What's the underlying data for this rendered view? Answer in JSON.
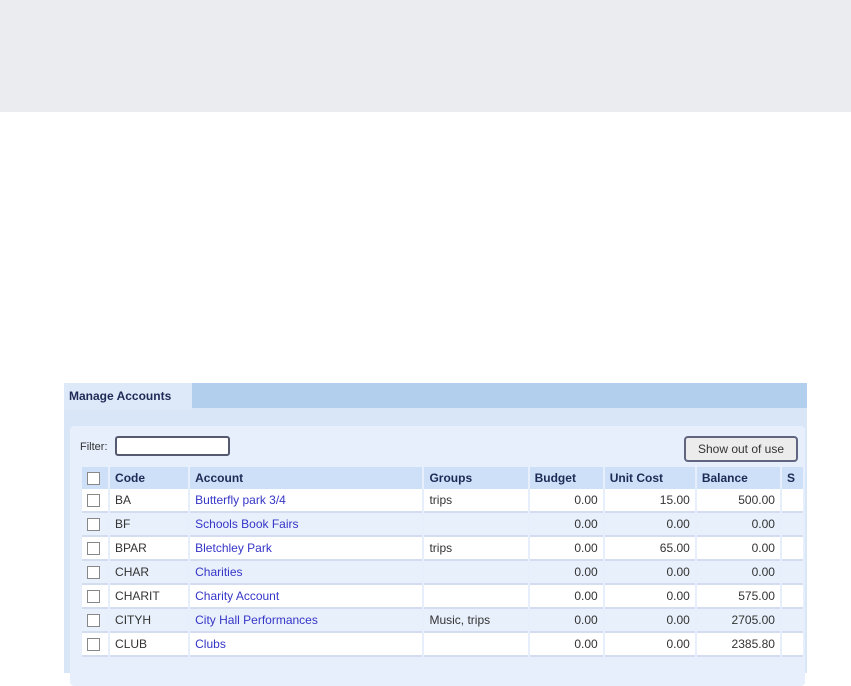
{
  "tab": "Manage Accounts",
  "filter": {
    "label": "Filter:",
    "value": ""
  },
  "show_out_of_use": "Show out of use",
  "columns": [
    "Code",
    "Account",
    "Groups",
    "Budget",
    "Unit Cost",
    "Balance",
    "S"
  ],
  "rows": [
    {
      "code": "BA",
      "account": "Butterfly park 3/4",
      "groups": "trips",
      "budget": "0.00",
      "unit_cost": "15.00",
      "balance": "500.00"
    },
    {
      "code": "BF",
      "account": "Schools Book Fairs",
      "groups": "",
      "budget": "0.00",
      "unit_cost": "0.00",
      "balance": "0.00"
    },
    {
      "code": "BPAR",
      "account": "Bletchley Park",
      "groups": "trips",
      "budget": "0.00",
      "unit_cost": "65.00",
      "balance": "0.00"
    },
    {
      "code": "CHAR",
      "account": "Charities",
      "groups": "",
      "budget": "0.00",
      "unit_cost": "0.00",
      "balance": "0.00"
    },
    {
      "code": "CHARIT",
      "account": "Charity Account",
      "groups": "",
      "budget": "0.00",
      "unit_cost": "0.00",
      "balance": "575.00"
    },
    {
      "code": "CITYH",
      "account": "City Hall Performances",
      "groups": "Music, trips",
      "budget": "0.00",
      "unit_cost": "0.00",
      "balance": "2705.00"
    },
    {
      "code": "CLUB",
      "account": "Clubs",
      "groups": "",
      "budget": "0.00",
      "unit_cost": "0.00",
      "balance": "2385.80"
    }
  ]
}
